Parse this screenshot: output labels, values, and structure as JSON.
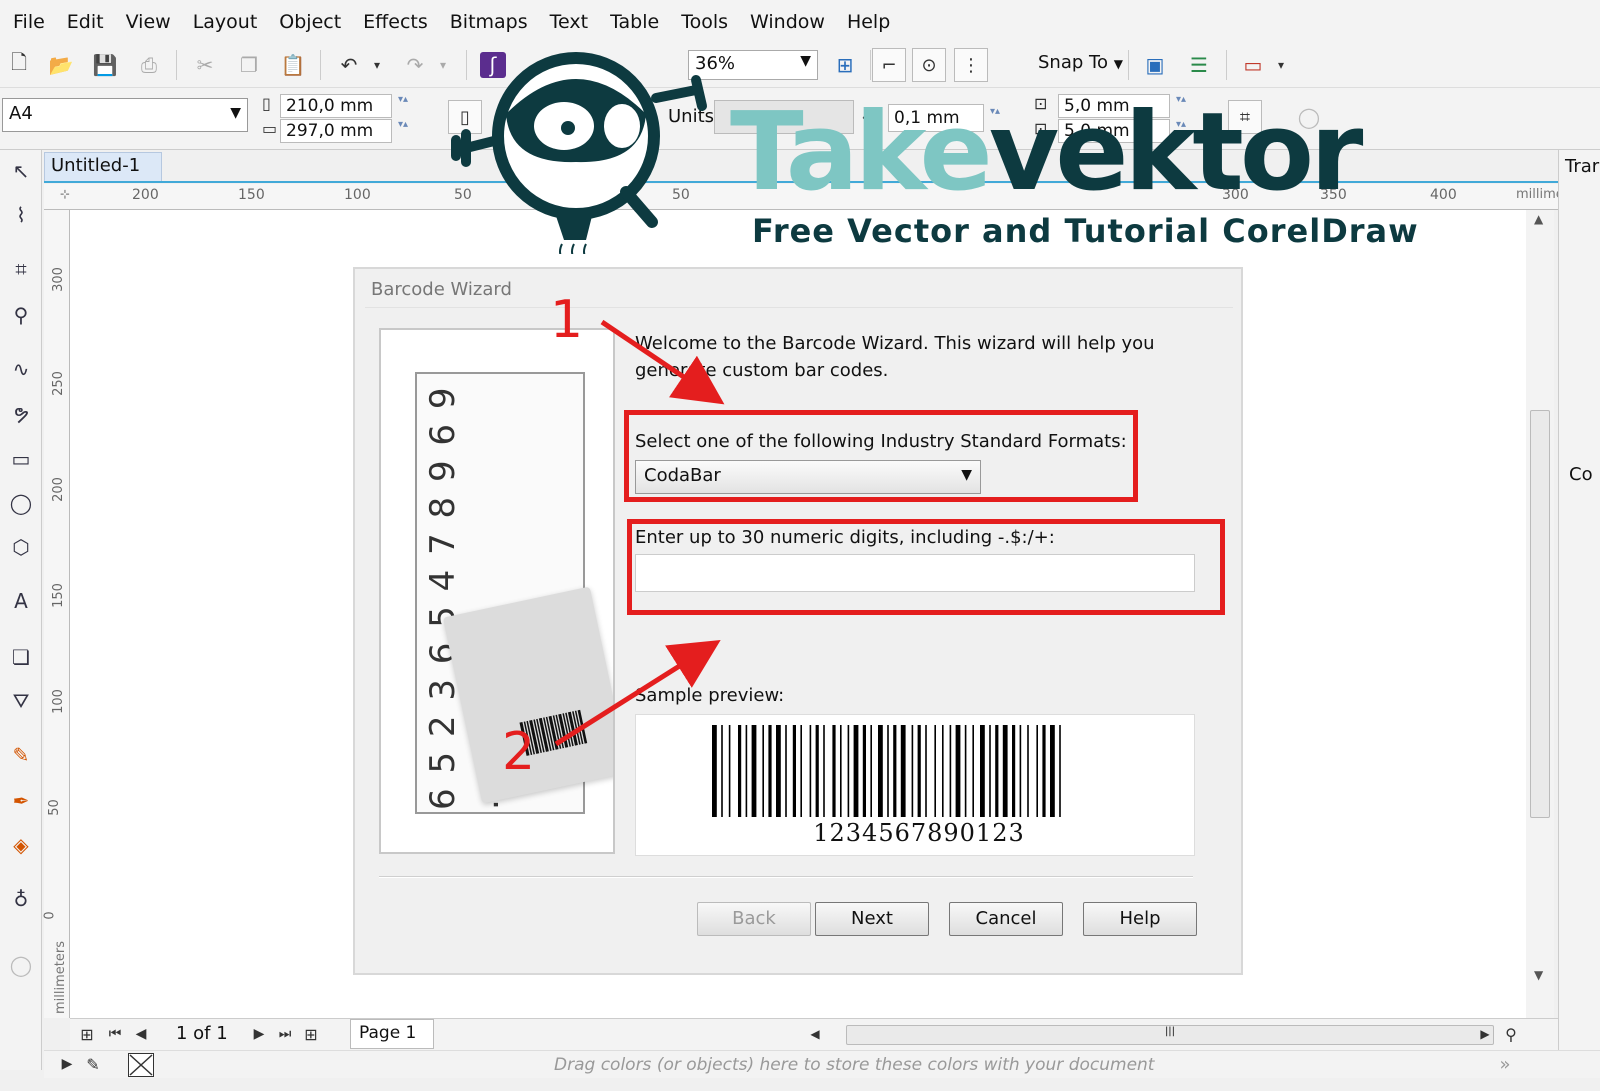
{
  "menu": [
    "File",
    "Edit",
    "View",
    "Layout",
    "Object",
    "Effects",
    "Bitmaps",
    "Text",
    "Table",
    "Tools",
    "Window",
    "Help"
  ],
  "toolbar": {
    "zoom": "36%",
    "snap_to": "Snap To"
  },
  "property_bar": {
    "page_size": "A4",
    "width": "210,0 mm",
    "height": "297,0 mm",
    "units_label": "Units:",
    "nudge": "0,1 mm",
    "dup_x": "5,0 mm",
    "dup_y": "5,0 mm"
  },
  "document": {
    "tab": "Untitled-1"
  },
  "rulers": {
    "h_labels": [
      "200",
      "150",
      "100",
      "50",
      "50",
      "300",
      "350",
      "400"
    ],
    "h_unit": "millimeters",
    "v_labels": [
      "300",
      "250",
      "200",
      "150",
      "100",
      "50",
      "0"
    ],
    "v_unit": "millimeters"
  },
  "right_panel": {
    "title": "Trar",
    "item": "Co"
  },
  "navigation": {
    "page_info": "1 of 1",
    "page_tab": "Page 1"
  },
  "palette": {
    "hint": "Drag colors (or objects) here to store these colors with your document"
  },
  "dialog": {
    "title": "Barcode Wizard",
    "welcome": "Welcome to the Barcode Wizard.  This wizard will help you generate custom bar codes.",
    "format_label": "Select one of the following Industry Standard Formats:",
    "format_value": "CodaBar",
    "digits_label": "Enter up to 30 numeric digits, including -.$:/+:",
    "digits_value": "",
    "preview_label": "Sample preview:",
    "preview_digits": "1234567890123",
    "illustration_digits": "6 5 2 3 6 5 4 7 8 9 6 9 .",
    "buttons": {
      "back": "Back",
      "next": "Next",
      "cancel": "Cancel",
      "help": "Help"
    }
  },
  "annotations": {
    "one": "1",
    "two": "2",
    "color": "#e41e1e"
  },
  "watermark": {
    "title_part1": "Take",
    "title_part2": "vektor",
    "subtitle": "Free Vector and Tutorial CorelDraw",
    "color_light": "#7ec6c3",
    "color_dark": "#0d3a40"
  }
}
